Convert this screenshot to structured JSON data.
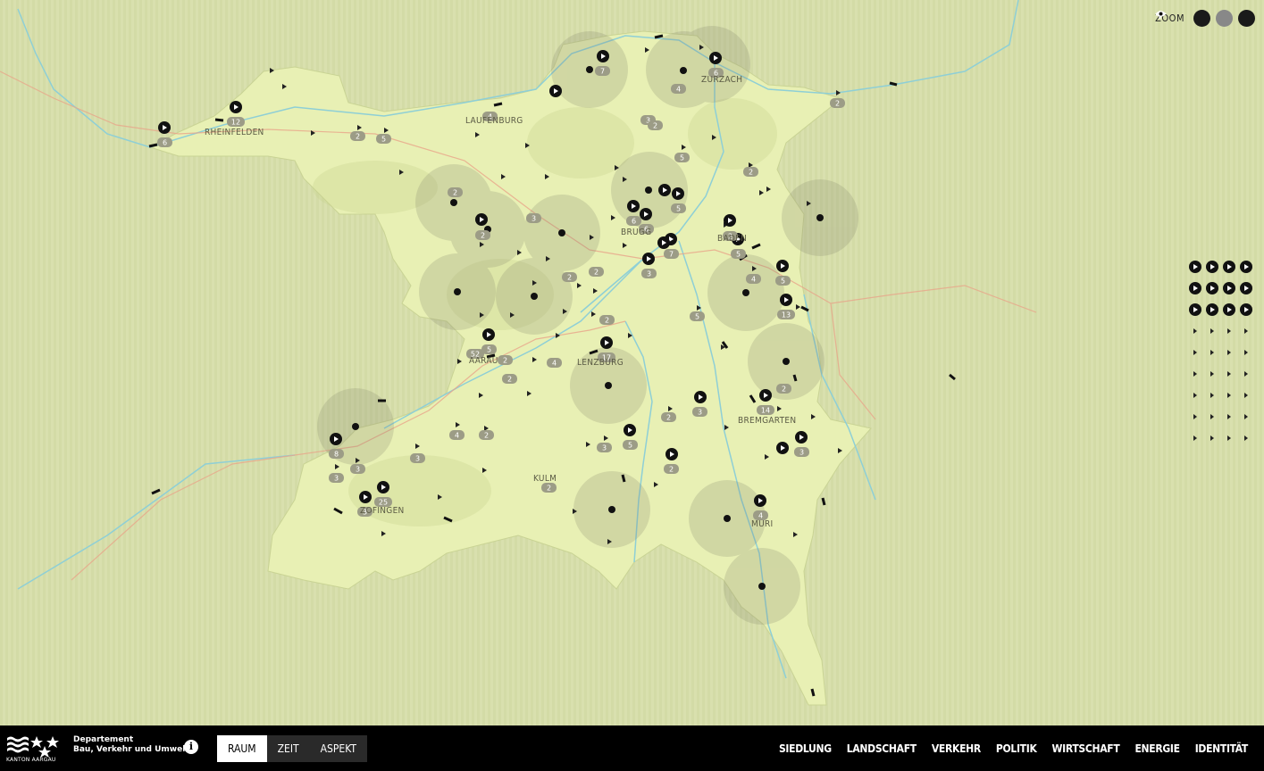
{
  "zoom": {
    "label": "ZOOM",
    "in_icon": "plus-icon",
    "out_icon": "minus-icon",
    "view_icon": "eye-icon"
  },
  "places": [
    {
      "name": "RHEINFELDEN"
    },
    {
      "name": "LAUFENBURG"
    },
    {
      "name": "ZURZACH"
    },
    {
      "name": "BRUGG"
    },
    {
      "name": "BADEN"
    },
    {
      "name": "AARAU"
    },
    {
      "name": "LENZBURG"
    },
    {
      "name": "BREMGARTEN"
    },
    {
      "name": "KULM"
    },
    {
      "name": "ZOFINGEN"
    },
    {
      "name": "MURI"
    }
  ],
  "badges": [
    "6",
    "12",
    "2",
    "5",
    "4",
    "7",
    "6",
    "3",
    "2",
    "2",
    "2",
    "5",
    "2",
    "3",
    "2",
    "2",
    "6",
    "6",
    "5",
    "7",
    "5",
    "2",
    "3",
    "5",
    "4",
    "5",
    "13",
    "5",
    "2",
    "52",
    "5",
    "2",
    "4",
    "2",
    "17",
    "2",
    "4",
    "2",
    "14",
    "3",
    "2",
    "3",
    "8",
    "3",
    "3",
    "3",
    "25",
    "2",
    "3",
    "5",
    "2",
    "3",
    "2",
    "4",
    "2"
  ],
  "footer": {
    "logo_text": "KANTON AARGAU",
    "dept_line1": "Departement",
    "dept_line2": "Bau, Verkehr und Umwelt",
    "info_icon": "info-icon",
    "modes": [
      {
        "label": "RAUM",
        "active": true
      },
      {
        "label": "ZEIT"
      },
      {
        "label": "ASPEKT"
      }
    ],
    "themes": [
      "SIEDLUNG",
      "LANDSCHAFT",
      "VERKEHR",
      "POLITIK",
      "WIRTSCHAFT",
      "ENERGIE",
      "IDENTITÄT"
    ]
  }
}
